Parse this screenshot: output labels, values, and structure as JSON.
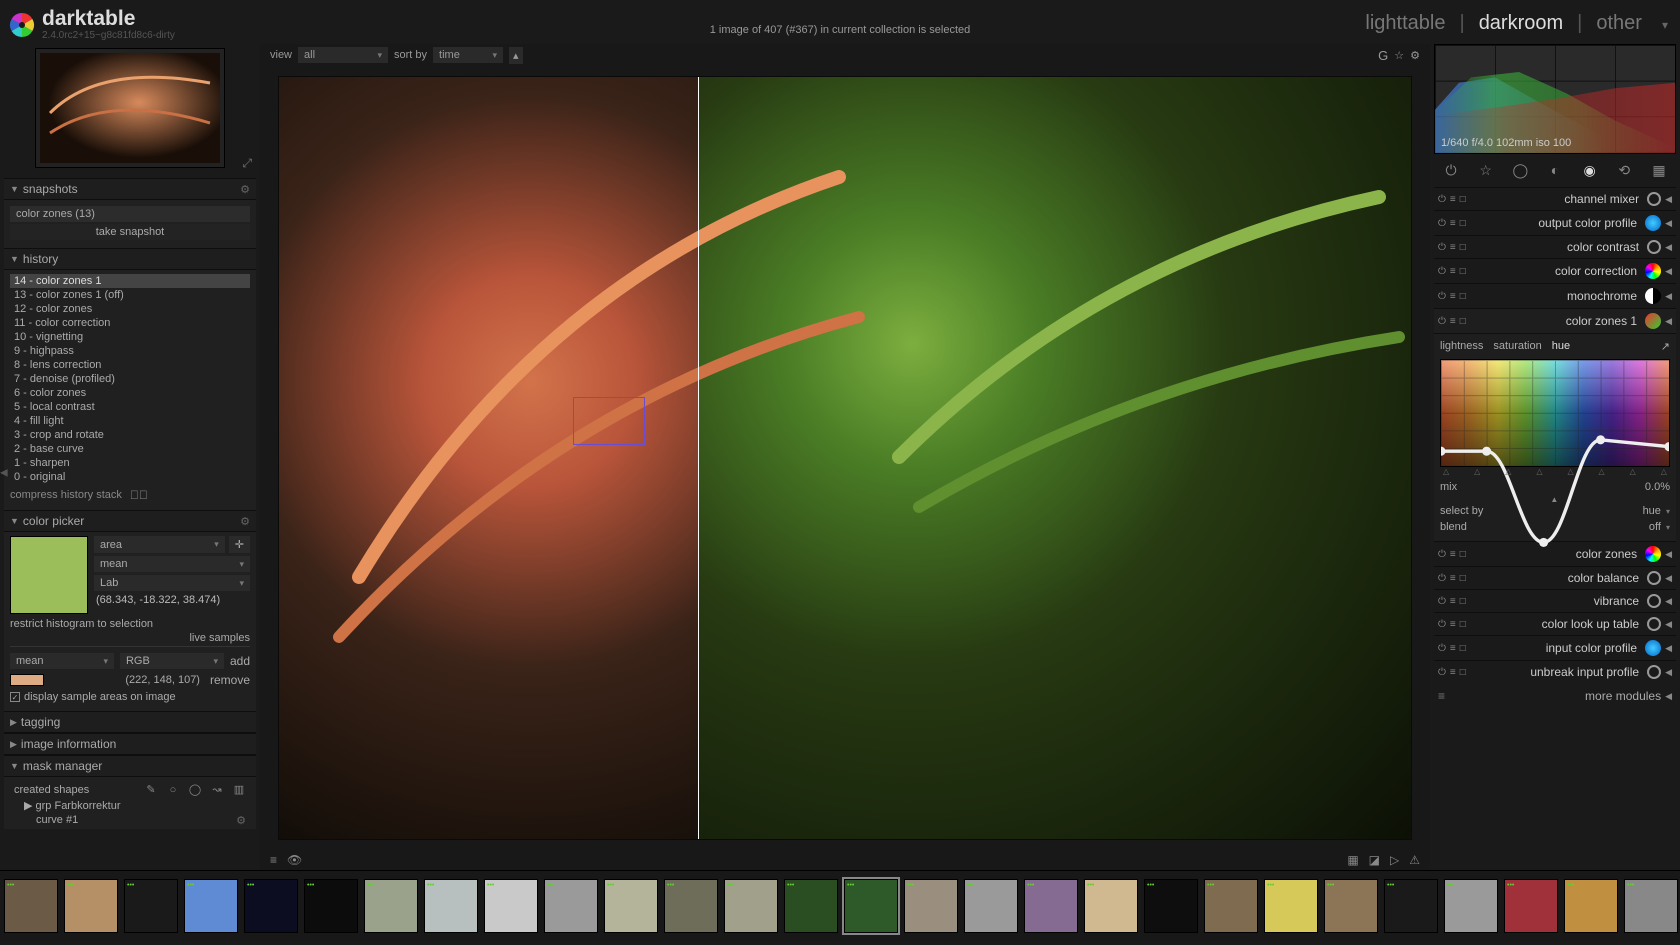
{
  "brand": {
    "name": "darktable",
    "version": "2.4.0rc2+15~g8c81fd8c6-dirty"
  },
  "top": {
    "status": "1 image of 407 (#367) in current collection is selected",
    "view_label": "view",
    "view_value": "all",
    "sort_label": "sort by",
    "sort_value": "time"
  },
  "nav": {
    "lighttable": "lighttable",
    "darkroom": "darkroom",
    "other": "other"
  },
  "left": {
    "snapshots": {
      "title": "snapshots",
      "entry": "color zones (13)",
      "take": "take snapshot"
    },
    "history": {
      "title": "history",
      "compress": "compress history stack",
      "items": [
        "14 - color zones 1",
        "13 - color zones 1 (off)",
        "12 - color zones",
        "11 - color correction",
        "10 - vignetting",
        "9 - highpass",
        "8 - lens correction",
        "7 - denoise (profiled)",
        "6 - color zones",
        "5 - local contrast",
        "4 - fill light",
        "3 - crop and rotate",
        "2 - base curve",
        "1 - sharpen",
        "0 - original"
      ]
    },
    "picker": {
      "title": "color picker",
      "mode": "area",
      "stat": "mean",
      "space": "Lab",
      "lab": "(68.343, -18.322, 38.474)",
      "restrict": "restrict histogram to selection",
      "live": "live samples",
      "mean2": "mean",
      "rgb": "RGB",
      "add": "add",
      "rgbval": "(222, 148, 107)",
      "remove": "remove",
      "display": "display sample areas on image"
    },
    "tagging": {
      "title": "tagging"
    },
    "info": {
      "title": "image information"
    },
    "mask": {
      "title": "mask manager",
      "created": "created shapes",
      "grp": "grp Farbkorrektur",
      "curve": "curve #1"
    }
  },
  "right": {
    "hist_meta": "1/640 f/4.0 102mm iso 100",
    "groups": [
      "power",
      "star",
      "ring",
      "contrast",
      "rainbow",
      "swap",
      "grid"
    ],
    "modules": [
      {
        "name": "channel mixer",
        "icon": "swap"
      },
      {
        "name": "output color profile",
        "icon": "blue"
      },
      {
        "name": "color contrast",
        "icon": "ring"
      },
      {
        "name": "color correction",
        "icon": "rainbow"
      },
      {
        "name": "monochrome",
        "icon": "bw"
      },
      {
        "name": "color zones 1",
        "icon": "redgr",
        "expanded": true
      },
      {
        "name": "color zones",
        "icon": "rainbow"
      },
      {
        "name": "color balance",
        "icon": "ring"
      },
      {
        "name": "vibrance",
        "icon": "ring"
      },
      {
        "name": "color look up table",
        "icon": "ring"
      },
      {
        "name": "input color profile",
        "icon": "blue"
      },
      {
        "name": "unbreak input profile",
        "icon": "ring"
      }
    ],
    "cz": {
      "tabs": [
        "lightness",
        "saturation",
        "hue"
      ],
      "mix_label": "mix",
      "mix_value": "0.0%",
      "selectby_label": "select by",
      "selectby_value": "hue",
      "blend_label": "blend",
      "blend_value": "off"
    },
    "more": "more modules"
  },
  "filmstrip_count": 29
}
